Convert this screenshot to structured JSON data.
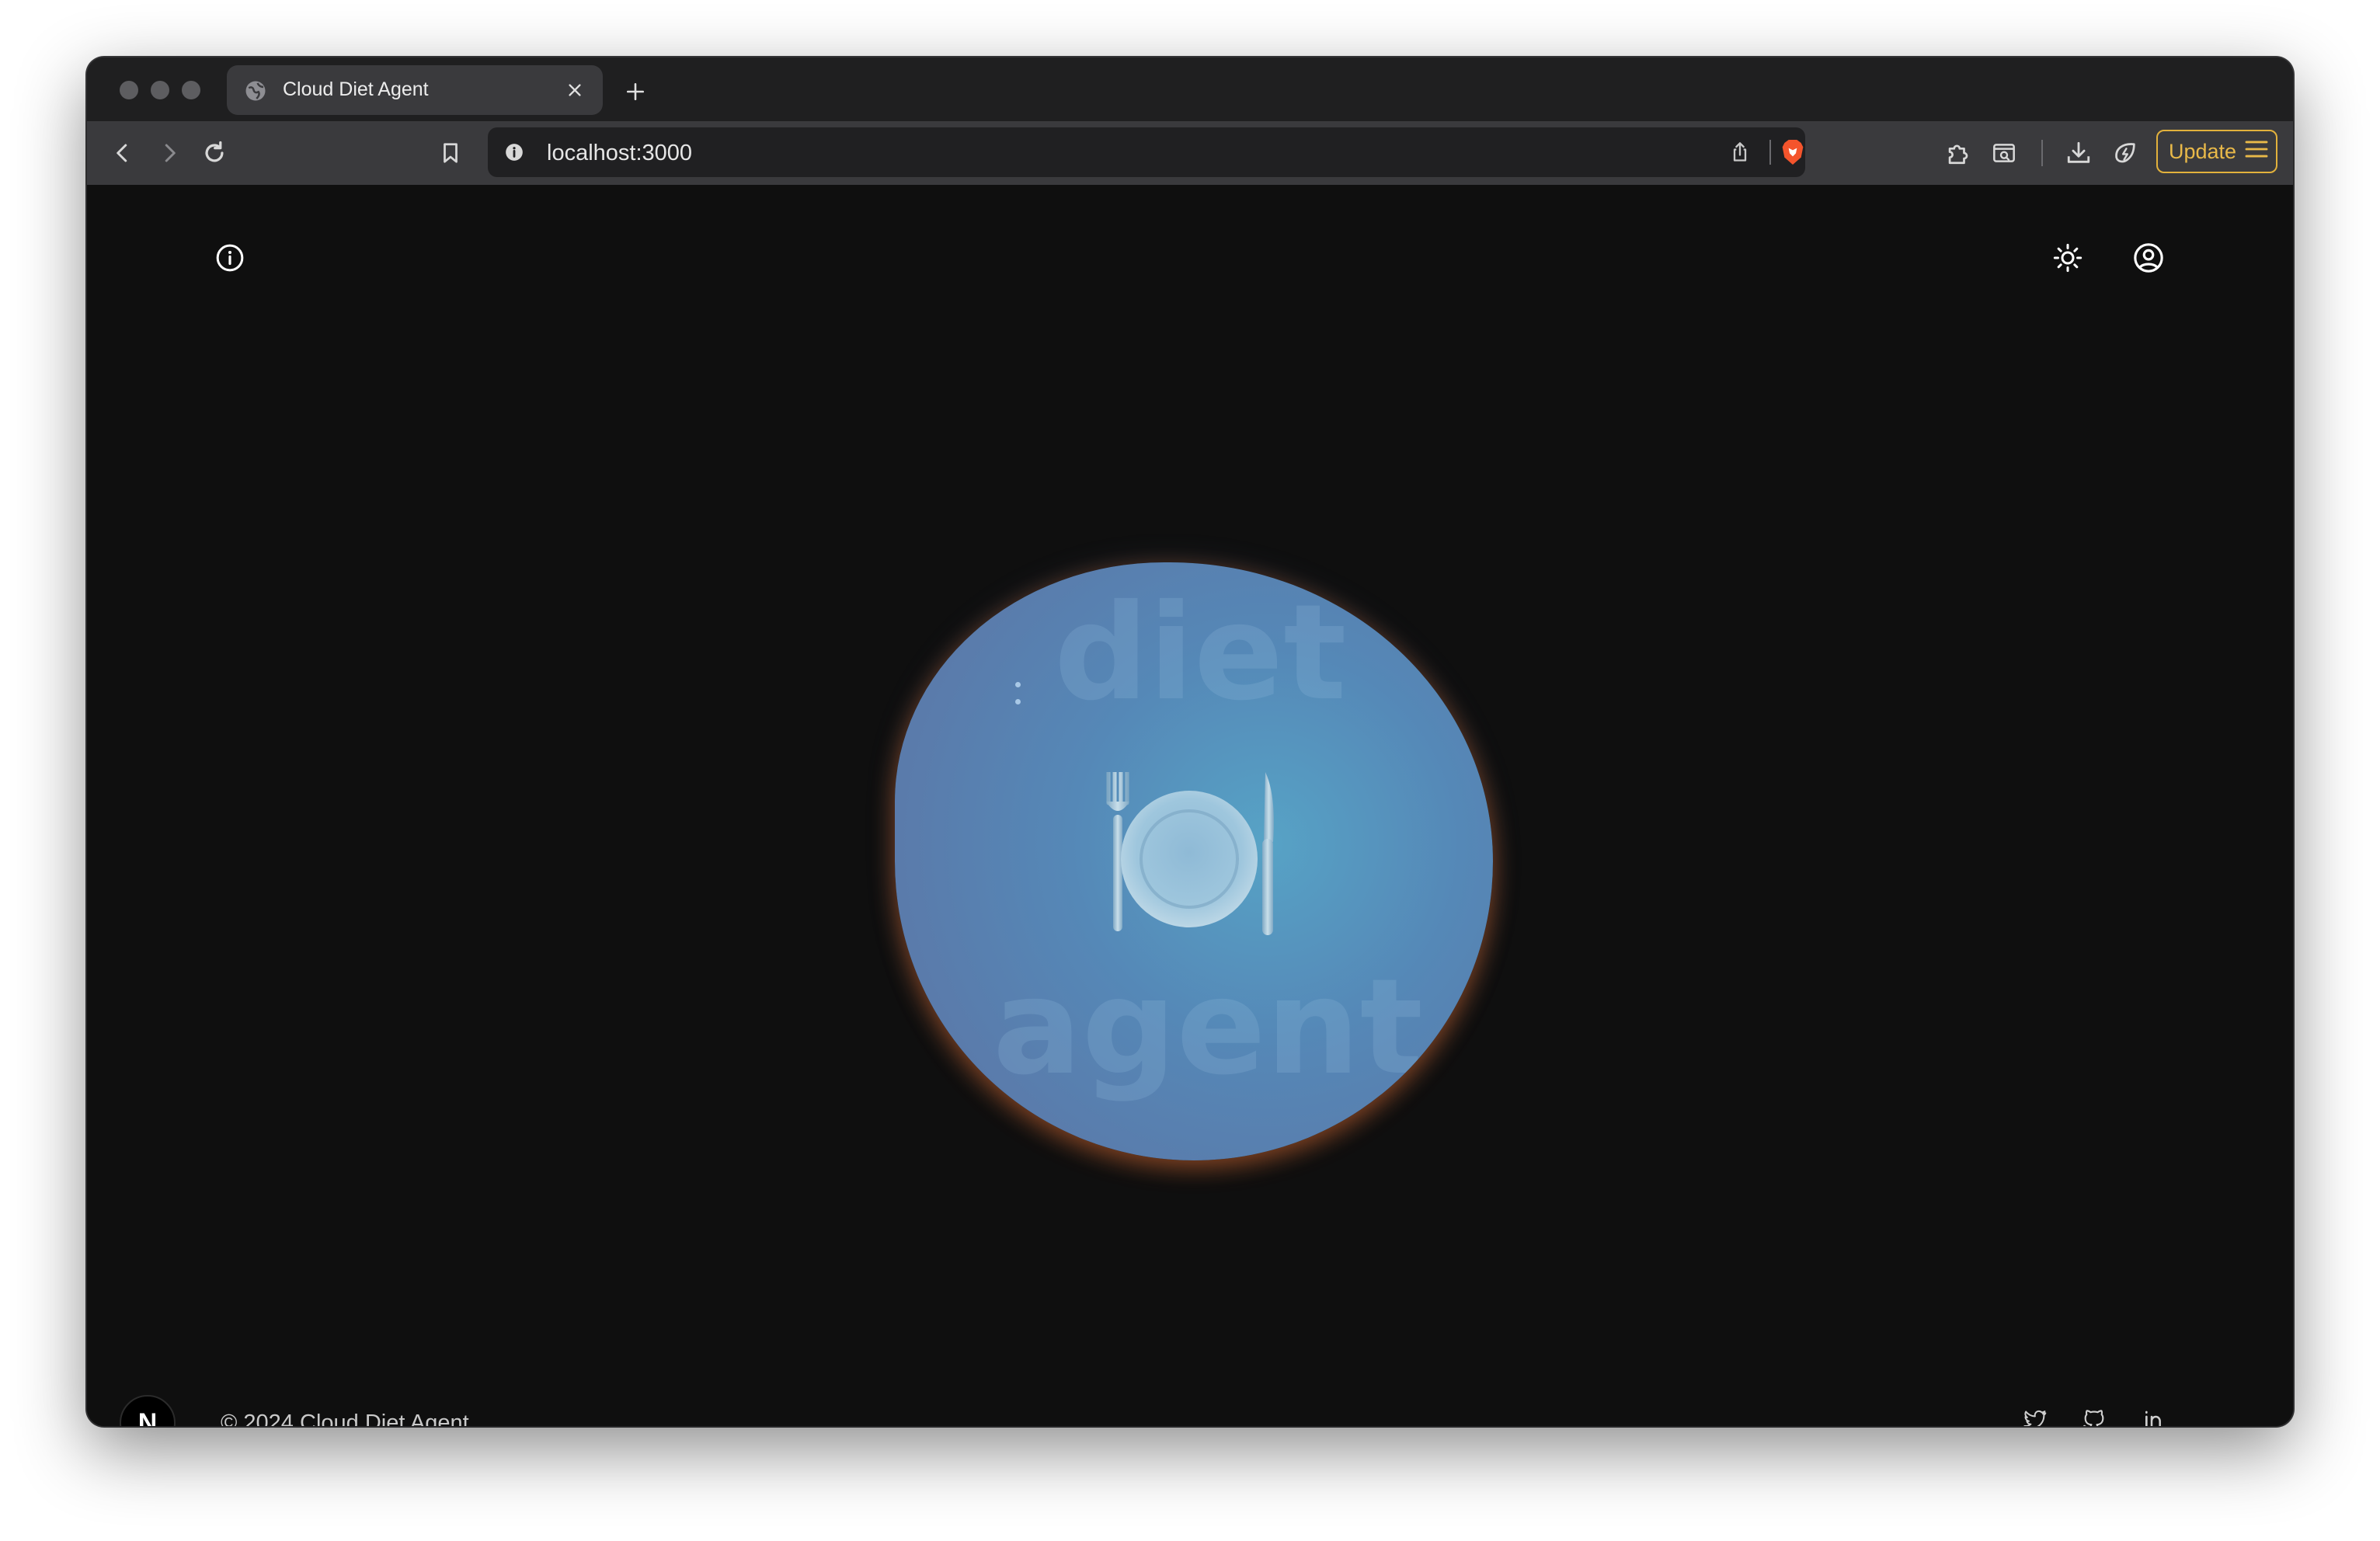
{
  "browser": {
    "tab_title": "Cloud Diet Agent",
    "url": "localhost:3000",
    "update_label": "Update"
  },
  "hero": {
    "word_top": "diet",
    "word_bottom": "agent",
    "emoji": "🍽️"
  },
  "footer": {
    "logo_letter": "N",
    "copyright": "© 2024 Cloud Diet Agent"
  },
  "colors": {
    "page_bg": "#0f0f0f",
    "blob": "#5a7bab",
    "blob_highlight": "#57a3c6",
    "glow": "#ff6e1e",
    "update_accent": "#e2b13c"
  },
  "icons": [
    "globe-icon",
    "close-icon",
    "plus-icon",
    "back-icon",
    "forward-icon",
    "reload-icon",
    "bookmark-icon",
    "info-icon",
    "share-icon",
    "brave-shield-icon",
    "extensions-icon",
    "reader-icon",
    "download-icon",
    "leo-icon",
    "menu-icon",
    "sun-icon",
    "user-circle-icon",
    "twitter-icon",
    "github-icon",
    "linkedin-icon"
  ]
}
